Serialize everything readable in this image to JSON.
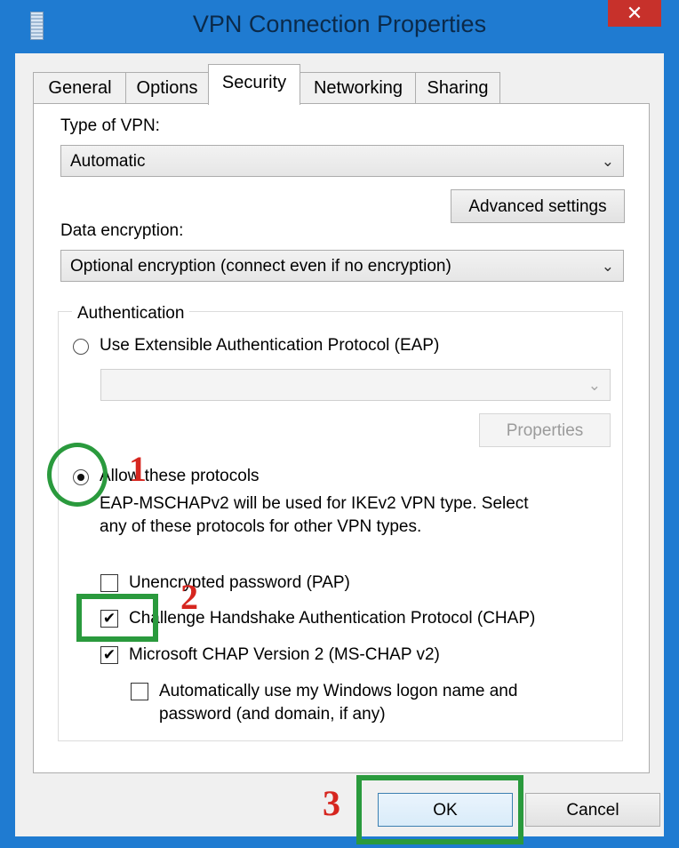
{
  "window": {
    "title": "VPN Connection Properties",
    "close_glyph": "✕"
  },
  "tabs": [
    {
      "label": "General"
    },
    {
      "label": "Options"
    },
    {
      "label": "Security"
    },
    {
      "label": "Networking"
    },
    {
      "label": "Sharing"
    }
  ],
  "active_tab": "Security",
  "security": {
    "vpn_type_label": "Type of VPN:",
    "vpn_type_value": "Automatic",
    "advanced_button": "Advanced settings",
    "encryption_label": "Data encryption:",
    "encryption_value": "Optional encryption (connect even if no encryption)",
    "chevron": "⌄"
  },
  "authentication": {
    "group_label": "Authentication",
    "eap_option": "Use Extensible Authentication Protocol (EAP)",
    "eap_value": "",
    "properties_button": "Properties",
    "allow_option": "Allow these protocols",
    "allow_note_line1": "EAP-MSCHAPv2 will be used for IKEv2 VPN type. Select",
    "allow_note_line2": "any of these protocols for other VPN types.",
    "selected": "allow",
    "protocols": [
      {
        "label": "Unencrypted password (PAP)",
        "checked": false
      },
      {
        "label": "Challenge Handshake Authentication Protocol (CHAP)",
        "checked": true
      },
      {
        "label": "Microsoft CHAP Version 2 (MS-CHAP v2)",
        "checked": true
      }
    ],
    "auto_logon_line1": "Automatically use my Windows logon name and",
    "auto_logon_line2": "password (and domain, if any)",
    "auto_logon_checked": false
  },
  "footer": {
    "ok": "OK",
    "cancel": "Cancel"
  },
  "annotations": {
    "n1": "1",
    "n2": "2",
    "n3": "3",
    "highlight_color": "#2a9a3d",
    "number_color": "#d6261f"
  },
  "colors": {
    "frame": "#1f7bd1",
    "close": "#c7312b"
  }
}
